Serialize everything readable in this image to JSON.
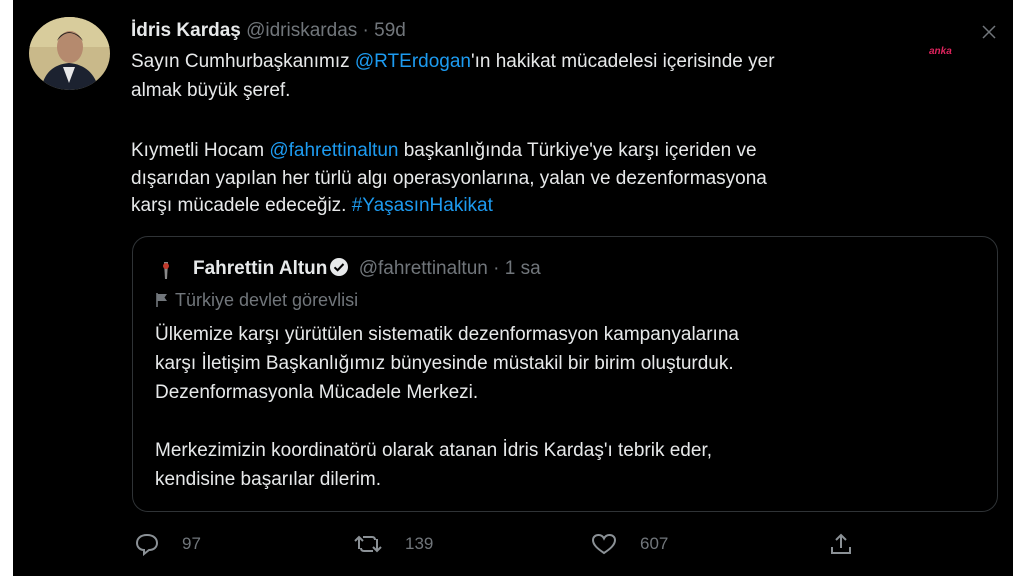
{
  "tweet": {
    "author_name": "İdris Kardaş",
    "handle": "@idriskardas",
    "separator": "·",
    "time": "59d",
    "line1_prefix": "Sayın Cumhurbaşkanımız ",
    "line1_mention": "@RTErdogan",
    "line1_suffix": "'ın hakikat mücadelesi içerisinde yer",
    "line2": "almak büyük şeref.",
    "line3_prefix": "Kıymetli Hocam ",
    "line3_mention": "@fahrettinaltun",
    "line3_suffix": " başkanlığında Türkiye'ye karşı içeriden ve",
    "line4": "dışarıdan yapılan her türlü algı operasyonlarına, yalan ve dezenformasyona",
    "line5_prefix": "karşı mücadele edeceğiz. ",
    "line5_hashtag": "#YaşasınHakikat"
  },
  "watermark": "anka",
  "quote": {
    "author_name": "Fahrettin Altun",
    "handle": "@fahrettinaltun",
    "separator": "·",
    "time": "1 sa",
    "label": "Türkiye devlet görevlisi",
    "lines": [
      "Ülkemize karşı yürütülen sistematik dezenformasyon kampanyalarına",
      "karşı İletişim Başkanlığımız bünyesinde müstakil bir birim oluşturduk.",
      "Dezenformasyonla Mücadele Merkezi.",
      "Merkezimizin koordinatörü olarak atanan İdris Kardaş'ı tebrik eder,",
      "kendisine başarılar dilerim."
    ]
  },
  "actions": {
    "reply_count": "97",
    "retweet_count": "139",
    "like_count": "607"
  },
  "icons": {
    "reply": "reply-icon",
    "retweet": "retweet-icon",
    "like": "heart-icon",
    "share": "share-icon",
    "close": "close-icon",
    "verified": "verified-badge-icon",
    "flag": "flag-icon"
  },
  "colors": {
    "background": "#000000",
    "text": "#e7e9ea",
    "secondary": "#71767b",
    "link": "#1d9bf0"
  }
}
